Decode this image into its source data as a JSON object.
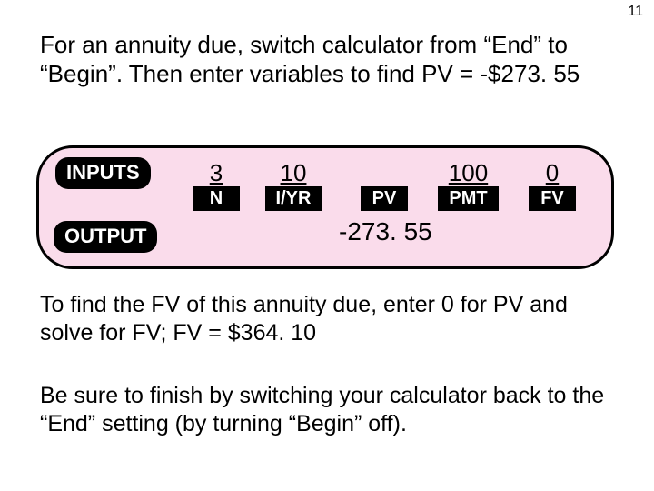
{
  "page_number": "11",
  "intro": "For an annuity due, switch calculator from “End” to “Begin”.  Then enter variables to find PV = -$273. 55",
  "calc": {
    "inputs_label": "INPUTS",
    "output_label": "OUTPUT",
    "cols": {
      "n": {
        "value": "3",
        "key": "N"
      },
      "iyr": {
        "value": "10",
        "key": "I/YR"
      },
      "pv": {
        "value": "",
        "key": "PV"
      },
      "pmt": {
        "value": "100",
        "key": "PMT"
      },
      "fv": {
        "value": "0",
        "key": "FV"
      }
    },
    "output_value": "-273. 55"
  },
  "para2": "To find the FV of this annuity due, enter 0 for PV and solve for FV;  FV = $364. 10",
  "para3": "Be sure to finish by switching your calculator back to the “End” setting (by turning “Begin” off)."
}
